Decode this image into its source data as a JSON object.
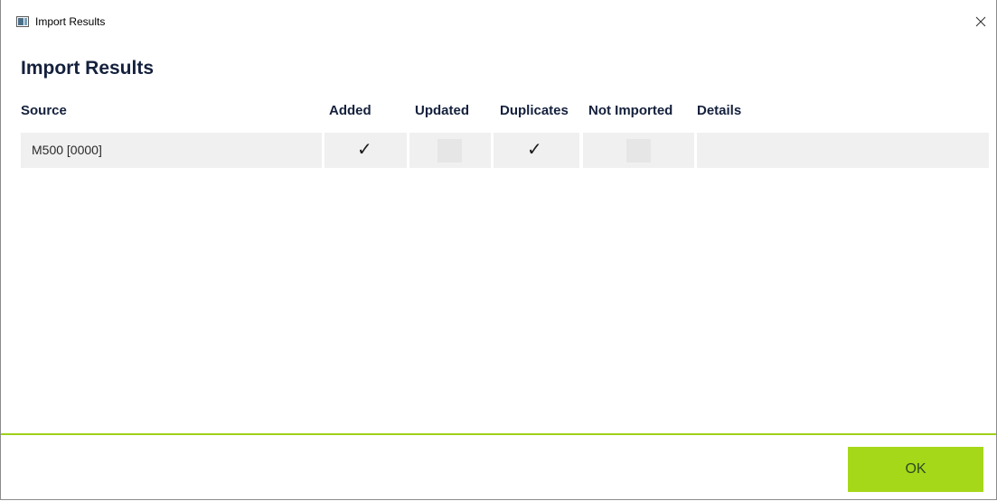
{
  "window": {
    "title": "Import Results"
  },
  "page": {
    "title": "Import Results"
  },
  "table": {
    "headers": {
      "source": "Source",
      "added": "Added",
      "updated": "Updated",
      "duplicates": "Duplicates",
      "not_imported": "Not Imported",
      "details": "Details"
    },
    "rows": [
      {
        "source": "M500 [0000]",
        "added": "✓",
        "updated": false,
        "duplicates": "✓",
        "not_imported": false,
        "details": ""
      }
    ]
  },
  "footer": {
    "ok_label": "OK"
  },
  "colors": {
    "accent": "#a6d81a",
    "heading": "#14203c",
    "row_bg": "#f0f0f0"
  },
  "icons": {
    "app": "window-app-icon",
    "close": "close-icon",
    "check": "checkmark-icon"
  }
}
